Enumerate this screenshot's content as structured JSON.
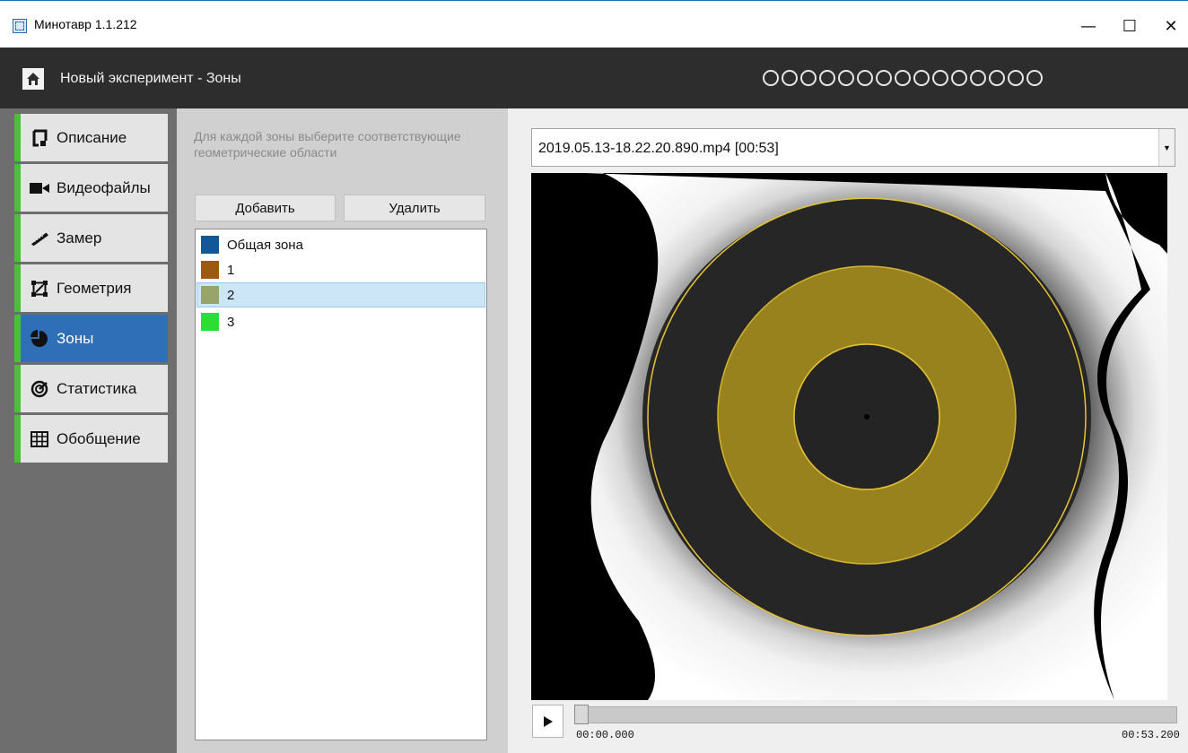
{
  "window": {
    "title": "Минотавр 1.1.212",
    "minimize_glyph": "—",
    "maximize_glyph": "☐",
    "close_glyph": "✕"
  },
  "header": {
    "title": "Новый эксперимент - Зоны",
    "progress_dots": 15,
    "icons": {
      "home": "home-icon"
    }
  },
  "sidebar": {
    "accent_color": "#48c134",
    "active_color": "#2f6fb8",
    "items": [
      {
        "label": "Описание",
        "icon": "description-icon"
      },
      {
        "label": "Видеофайлы",
        "icon": "video-camera-icon"
      },
      {
        "label": "Замер",
        "icon": "ruler-icon"
      },
      {
        "label": "Геометрия",
        "icon": "geometry-icon"
      },
      {
        "label": "Зоны",
        "icon": "pie-chart-icon",
        "active": true
      },
      {
        "label": "Статистика",
        "icon": "statistics-icon"
      },
      {
        "label": "Обобщение",
        "icon": "table-icon"
      }
    ]
  },
  "zones_panel": {
    "hint": "Для каждой зоны выберите соответствующие геометрические области",
    "add_label": "Добавить",
    "delete_label": "Удалить",
    "zones": [
      {
        "label": "Общая зона",
        "color": "#135796"
      },
      {
        "label": "1",
        "color": "#9c5a10"
      },
      {
        "label": "2",
        "color": "#98a46a",
        "selected": true
      },
      {
        "label": "3",
        "color": "#2fdc33"
      }
    ]
  },
  "video": {
    "file": "2019.05.13-18.22.20.890.mp4 [00:53]",
    "time_start": "00:00.000",
    "time_end": "00:53.200",
    "playback_progress": 0,
    "zone_overlay_color": "#e6c335",
    "icons": {
      "play": "play-icon",
      "dropdown": "chevron-down-icon"
    }
  }
}
